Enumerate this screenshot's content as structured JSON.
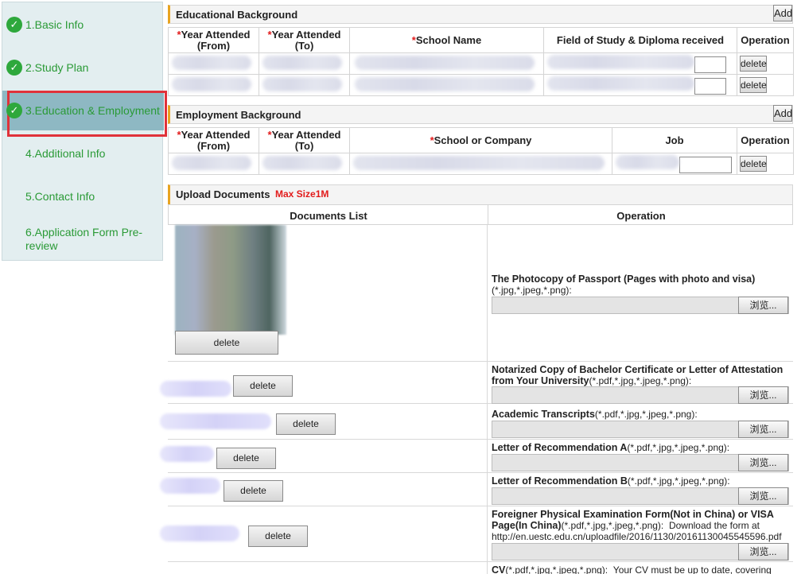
{
  "sidebar": {
    "steps": [
      {
        "label": "1.Basic Info"
      },
      {
        "label": "2.Study Plan"
      },
      {
        "label": "3.Education & Employment"
      },
      {
        "label": "4.Additional Info"
      },
      {
        "label": "5.Contact Info"
      },
      {
        "label": "6.Application Form Pre-review"
      }
    ],
    "check_glyph": "✓"
  },
  "education": {
    "title": "Educational Background",
    "add_label": "Add",
    "columns": [
      "Year Attended (From)",
      "Year Attended (To)",
      "School Name",
      "Field of Study & Diploma received",
      "Operation"
    ],
    "required_mark": "*",
    "delete_label": "delete"
  },
  "employment": {
    "title": "Employment Background",
    "add_label": "Add",
    "columns": [
      "Year Attended (From)",
      "Year Attended (To)",
      "School or Company",
      "Job",
      "Operation"
    ],
    "required_mark": "*",
    "delete_label": "delete"
  },
  "uploads": {
    "title": "Upload Documents",
    "max_size": "Max Size1M",
    "col_documents": "Documents List",
    "col_operation": "Operation",
    "browse_label": "浏览...",
    "delete_label": "delete",
    "docs": [
      {
        "title": "The Photocopy of Passport (Pages with photo and visa)",
        "formats": "(*.jpg,*.jpeg,*.png):"
      },
      {
        "title": "Notarized Copy of Bachelor Certificate or Letter of Attestation from Your University",
        "formats": "(*.pdf,*.jpg,*.jpeg,*.png):"
      },
      {
        "title": "Academic Transcripts",
        "formats": "(*.pdf,*.jpg,*.jpeg,*.png):"
      },
      {
        "title": "Letter of Recommendation A",
        "formats": "(*.pdf,*.jpg,*.jpeg,*.png):"
      },
      {
        "title": "Letter of Recommendation B",
        "formats": "(*.pdf,*.jpg,*.jpeg,*.png):"
      },
      {
        "title": "Foreigner Physical Examination Form(Not in China) or VISA Page(In China)",
        "formats": "(*.pdf,*.jpg,*.jpeg,*.png):",
        "extra": "Download the form at http://en.uestc.edu.cn/uploadfile/2016/1130/20161130045545596.pdf"
      },
      {
        "title": "CV",
        "formats": "(*.pdf,*.jpg,*.jpeg,*.png):",
        "extra": "Your CV must be up to date, covering"
      }
    ]
  },
  "colors": {
    "accent_green": "#2ea83c",
    "active_step_bg": "#8eb8c3",
    "highlight_red": "#e0323a",
    "required_red": "#e21b1b"
  }
}
